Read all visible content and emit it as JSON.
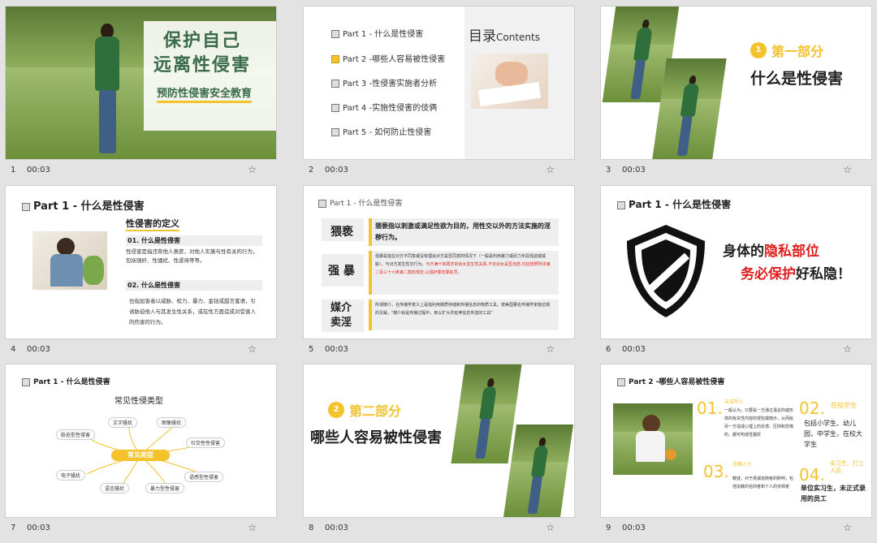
{
  "slides": [
    {
      "num": "1",
      "time": "00:03",
      "title_line1": "保护自己",
      "title_line2": "远离性侵害",
      "subtitle": "预防性侵害安全教育"
    },
    {
      "num": "2",
      "time": "00:03",
      "toc_title": "目录",
      "toc_title_en": "Contents",
      "items": [
        "Part 1 - 什么是性侵害",
        "Part 2 -哪些人容易被性侵害",
        "Part 3 -性侵害实施者分析",
        "Part 4 -实施性侵害的伎俩",
        "Part 5 - 如何防止性侵害"
      ]
    },
    {
      "num": "3",
      "time": "00:03",
      "badge": "1",
      "section": "第一部分",
      "heading": "什么是性侵害"
    },
    {
      "num": "4",
      "time": "00:03",
      "header": "Part 1 - 什么是性侵害",
      "def_title": "性侵害的定义",
      "p1_label": "01. 什么是性侵害",
      "p1_text": "性侵害是指违背他人意愿，对他人实施与性有关的行为，包括强奸、性骚扰、性虐待等等。",
      "p2_label": "02. 什么是性侵害",
      "p2_text": "也指加害者以威胁、权力、暴力、金钱或甜言蜜语，引诱胁迫他人与其发生性关系，或在性方面造成对受害人的伤害的行为。"
    },
    {
      "num": "5",
      "time": "00:03",
      "header": "Part 1 - 什么是性侵害",
      "rows": [
        {
          "label": "猥亵",
          "text": "猥亵指以刺激或满足性欲为目的，用性交以外的方法实施的淫秽行为。"
        },
        {
          "label": "强 暴",
          "text": "强暴是指在对方不同意或没有理会对方是否同意的情况下（一般是利用暴力或武力手段强迫或威胁），与对方发生性交行为。",
          "text_red": "与不满十四周岁的幼女发生性关系,不论幼女是否自愿,均应按照刑法第二百三十六条第二款的规定,以强奸罪定罪处罚。"
        },
        {
          "label": "媒介卖淫",
          "text": "所谓媒介，在传播学意义上是指利用媒质存储和传播信息的物质工具。按美国著名传播学家施拉姆的见解，\"媒介就是传播过程中，用以扩大并延伸信息传送的工具\""
        }
      ]
    },
    {
      "num": "6",
      "time": "00:03",
      "header": "Part 1 - 什么是性侵害",
      "line1_a": "身体的",
      "line1_b": "隐私部位",
      "line2_a": "务必保护",
      "line2_b": "好私隐！"
    },
    {
      "num": "7",
      "time": "00:03",
      "header": "Part 1 - 什么是性侵害",
      "title": "常见性侵类型",
      "center": "常见类型",
      "nodes": [
        "文字骚扰",
        "图像骚扰",
        "社交性性侵害",
        "语感型性侵害",
        "暴力型性侵害",
        "语言骚扰",
        "电子骚扰",
        "胁迫型性侵害"
      ]
    },
    {
      "num": "8",
      "time": "00:03",
      "badge": "2",
      "section": "第二部分",
      "heading": "哪些人容易被性侵害"
    },
    {
      "num": "9",
      "time": "00:03",
      "header": "Part 2 -哪些人容易被性侵害",
      "q": [
        {
          "n": "01.",
          "t": "未成年人",
          "d": "一般认为，只要是一方通过语言的或形体的有关性内容的侵犯或暗示，从而给另一方造成心理上的反感、压抑和恐慌的，都可构成性骚扰"
        },
        {
          "n": "02.",
          "t": "在校学生",
          "d": "包括小学生、幼儿园，中学生，在校大学生"
        },
        {
          "n": "03.",
          "t": "信教人士",
          "d": "教徒，对于虔诚追随者的盼咐，包括宗教的信仰者和个人的崇拜者"
        },
        {
          "n": "04.",
          "t": "实习生、打工人员",
          "d": "单位实习生，未正式录用的员工"
        }
      ]
    }
  ],
  "colors": {
    "accent": "#f4c22b",
    "red": "#e02020",
    "green": "#3a6b4c"
  }
}
